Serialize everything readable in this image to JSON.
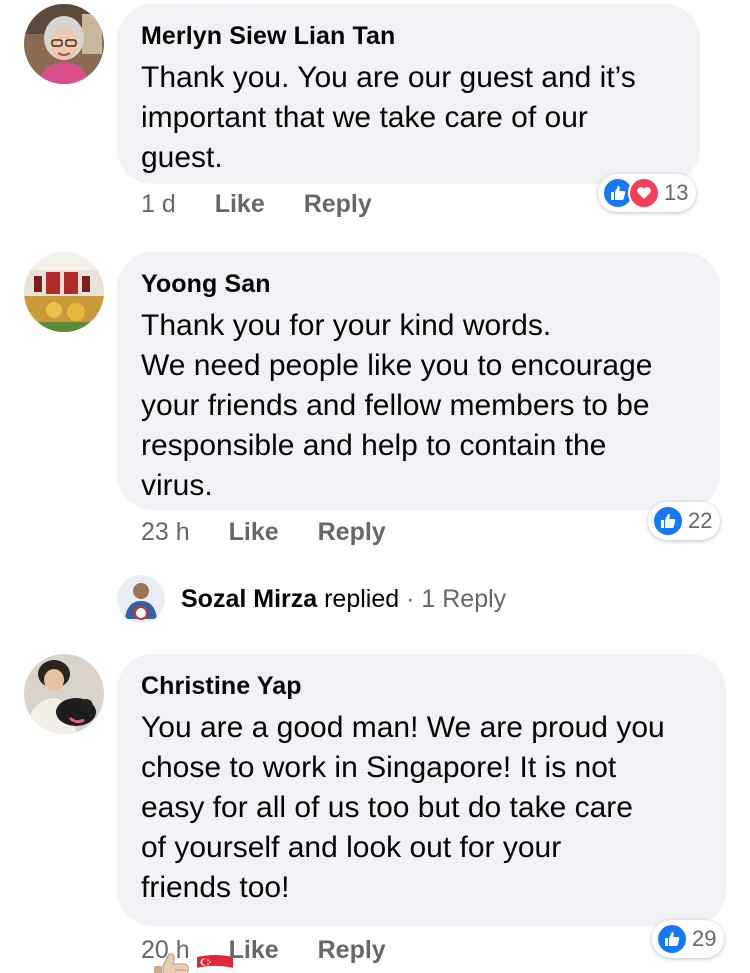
{
  "comments": [
    {
      "author": "Merlyn Siew Lian Tan",
      "text": "Thank you. You are our guest and it’s\nimportant that we take care of our\nguest.",
      "time": "1 d",
      "like_label": "Like",
      "reply_label": "Reply",
      "reaction_icons": [
        "like-icon",
        "love-icon"
      ],
      "reaction_count": "13"
    },
    {
      "author": "Yoong San",
      "text": "Thank you for your kind words.\nWe need people like you to encourage\nyour friends and fellow members to be\nresponsible and help to contain the\nvirus.",
      "time": "23 h",
      "like_label": "Like",
      "reply_label": "Reply",
      "reaction_icons": [
        "like-icon"
      ],
      "reaction_count": "22"
    },
    {
      "author": "Christine Yap",
      "text": "You are a good man! We are proud you\nchose to work in Singapore! It is not\neasy for all of us too but do take care\nof yourself and look out for your\nfriends too!",
      "emojis": [
        "thumbs-up-emoji",
        "singapore-flag-emoji"
      ],
      "time": "20 h",
      "like_label": "Like",
      "reply_label": "Reply",
      "reaction_icons": [
        "like-icon"
      ],
      "reaction_count": "29"
    }
  ],
  "reply_summary": {
    "name": "Sozal Mirza",
    "action": "replied",
    "separator": "·",
    "count_label": "1 Reply"
  },
  "colors": {
    "bubble": "#f0f2f5",
    "secondary_text": "#65676b",
    "like_blue": "#1877f2",
    "love_red": "#f33e58"
  }
}
